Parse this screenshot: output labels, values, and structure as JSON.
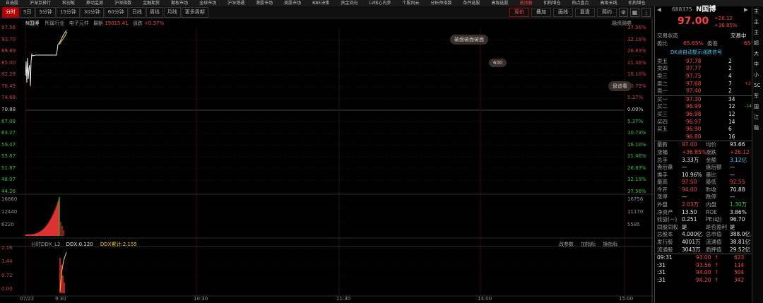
{
  "menu": [
    "自选股",
    "沪深京排行",
    "科创板",
    "移动监测",
    "沪深指数",
    "金融期货",
    "期权市场",
    "全球市场",
    "沪深港通",
    "港股市场",
    "美股市场",
    "BBE决策",
    "资金流向",
    "L2核心内参",
    "个股风云",
    "分析师指数",
    "条件选股",
    "高级选股",
    "逃顶器",
    "机构增仓",
    "热点盘点",
    "高级长线",
    "机构增仓"
  ],
  "toolbar": {
    "tabs": [
      "分时",
      "5日",
      "5分钟",
      "15分钟",
      "30分钟",
      "60分钟",
      "日线",
      "周线",
      "月线",
      "更多周期"
    ],
    "right": [
      "竞价",
      "叠加",
      "画线",
      "复盘",
      "简约"
    ],
    "icons": [
      "settings-icon",
      "grid-icon",
      "more-icon"
    ]
  },
  "main_chart": {
    "stock": "N国博",
    "industry_label": "所属行业",
    "industry": "电子元件",
    "latest_label": "最新",
    "latest": "19015.41",
    "change_label": "涨跌",
    "change": "+0.37%",
    "legend_right": "融资融券",
    "y_left": [
      "97.56",
      "93.70",
      "89.89",
      "85.00",
      "82.29",
      "78.49",
      "74.68",
      "70.88",
      "67.08",
      "63.27",
      "59.47",
      "55.67",
      "51.87",
      "48.07",
      "44.26"
    ],
    "y_right": [
      "37.56%",
      "32.19%",
      "26.83%",
      "21.46%",
      "16.10%",
      "10.73%",
      "5.37%",
      "0.00%",
      "5.37%",
      "10.73%",
      "16.10%",
      "21.46%",
      "26.83%",
      "32.19%",
      "37.56%"
    ],
    "tags": [
      "破面破面破面",
      "600",
      "盘该看"
    ]
  },
  "volume_chart": {
    "y_left": [
      "16660",
      "12440",
      "6220"
    ],
    "y_right": [
      "16756",
      "11170",
      "5585"
    ]
  },
  "ddx_chart": {
    "name": "分时DDX_L2",
    "ddx_label": "DDX:0.120",
    "ddx_sum_label": "DDX累计:2.155",
    "buttons": [
      "改参数",
      "加指标",
      "换指标"
    ],
    "y_left": [
      "2.16",
      "1.44",
      "0.72",
      "0.00"
    ]
  },
  "time_axis": [
    "07/22",
    "9:30",
    "10:30",
    "11:30",
    "14:00",
    "15:00"
  ],
  "right_panel": {
    "code": "688375",
    "name": "N国博",
    "price": "97.00",
    "change": "+26.12",
    "change_pct": "+36.85%",
    "status_label": "交易状态",
    "status": "交易中",
    "weibi_label": "委比",
    "weibi": "65.65%",
    "weicha_label": "委差",
    "weicha": "65",
    "signal": "DK点自动提示涨跌信号",
    "asks": [
      {
        "label": "卖五",
        "price": "97.78",
        "vol": "2",
        "delta": ""
      },
      {
        "label": "卖四",
        "price": "97.77",
        "vol": "2",
        "delta": ""
      },
      {
        "label": "卖三",
        "price": "97.75",
        "vol": "4",
        "delta": ""
      },
      {
        "label": "卖二",
        "price": "97.68",
        "vol": "7",
        "delta": "+2"
      },
      {
        "label": "卖一",
        "price": "97.40",
        "vol": "2",
        "delta": ""
      }
    ],
    "bids": [
      {
        "label": "买一",
        "price": "97.30",
        "vol": "34",
        "delta": ""
      },
      {
        "label": "买二",
        "price": "96.99",
        "vol": "12",
        "delta": "-14"
      },
      {
        "label": "买三",
        "price": "96.98",
        "vol": "12",
        "delta": ""
      },
      {
        "label": "买四",
        "price": "96.97",
        "vol": "14",
        "delta": ""
      },
      {
        "label": "买五",
        "price": "96.90",
        "vol": "6",
        "delta": ""
      },
      {
        "label": "",
        "price": "96.80",
        "vol": "16",
        "delta": ""
      }
    ],
    "stats": [
      {
        "l1": "最新",
        "v1": "97.00",
        "c1": "red",
        "l2": "均价",
        "v2": "93.66",
        "c2": "wht"
      },
      {
        "l1": "涨幅",
        "v1": "+36.85%",
        "c1": "red",
        "l2": "涨跌",
        "v2": "+26.12",
        "c2": "red"
      },
      {
        "l1": "总手",
        "v1": "3.33万",
        "c1": "wht",
        "l2": "金额",
        "v2": "3.12亿",
        "c2": "cyn"
      },
      {
        "l1": "盘后量",
        "v1": "—",
        "c1": "wht",
        "l2": "盘后额",
        "v2": "—",
        "c2": "wht"
      },
      {
        "l1": "换手",
        "v1": "10.96%",
        "c1": "wht",
        "l2": "量比",
        "v2": "—",
        "c2": "wht"
      },
      {
        "l1": "最高",
        "v1": "97.50",
        "c1": "red",
        "l2": "最低",
        "v2": "92.55",
        "c2": "red"
      },
      {
        "l1": "今开",
        "v1": "94.00",
        "c1": "red",
        "l2": "昨收",
        "v2": "70.88",
        "c2": "wht"
      },
      {
        "l1": "涨停",
        "v1": "—",
        "c1": "wht",
        "l2": "跌停",
        "v2": "—",
        "c2": "wht"
      },
      {
        "l1": "外盘",
        "v1": "2.03万",
        "c1": "red",
        "l2": "内盘",
        "v2": "1.30万",
        "c2": "grn"
      },
      {
        "l1": "净资产",
        "v1": "13.50",
        "c1": "wht",
        "l2": "ROE",
        "v2": "3.86%",
        "c2": "wht"
      },
      {
        "l1": "收益(一)",
        "v1": "0.251",
        "c1": "wht",
        "l2": "PE(动)",
        "v2": "96.70",
        "c2": "wht"
      },
      {
        "l1": "同股同权",
        "v1": "是",
        "c1": "wht",
        "l2": "是否盈利",
        "v2": "是",
        "c2": "wht"
      },
      {
        "l1": "总股本",
        "v1": "4.000亿",
        "c1": "wht",
        "l2": "总市值",
        "v2": "388.0亿",
        "c2": "wht"
      },
      {
        "l1": "发行股",
        "v1": "4001万",
        "c1": "wht",
        "l2": "流通值",
        "v2": "38.81亿",
        "c2": "wht"
      },
      {
        "l1": "流通股",
        "v1": "3043万",
        "c1": "wht",
        "l2": "质押值",
        "v2": "29.52亿",
        "c2": "wht"
      }
    ],
    "ticks": [
      {
        "time": "09:31",
        "price": "93.00",
        "vol": "623"
      },
      {
        "time": ":31",
        "price": "93.56",
        "vol": "114"
      },
      {
        "time": ":31",
        "price": "94.00",
        "vol": "504"
      },
      {
        "time": ":31",
        "price": "94.20",
        "vol": "342"
      }
    ]
  },
  "side_strip": [
    "主",
    "主",
    "主",
    "超",
    "大",
    "中",
    "小",
    "",
    "",
    "",
    "",
    "",
    "",
    "",
    "",
    "",
    "",
    "",
    "",
    "",
    "",
    "",
    "",
    "",
    "",
    "",
    "",
    "5C",
    "军",
    "国",
    "江",
    "融"
  ]
}
